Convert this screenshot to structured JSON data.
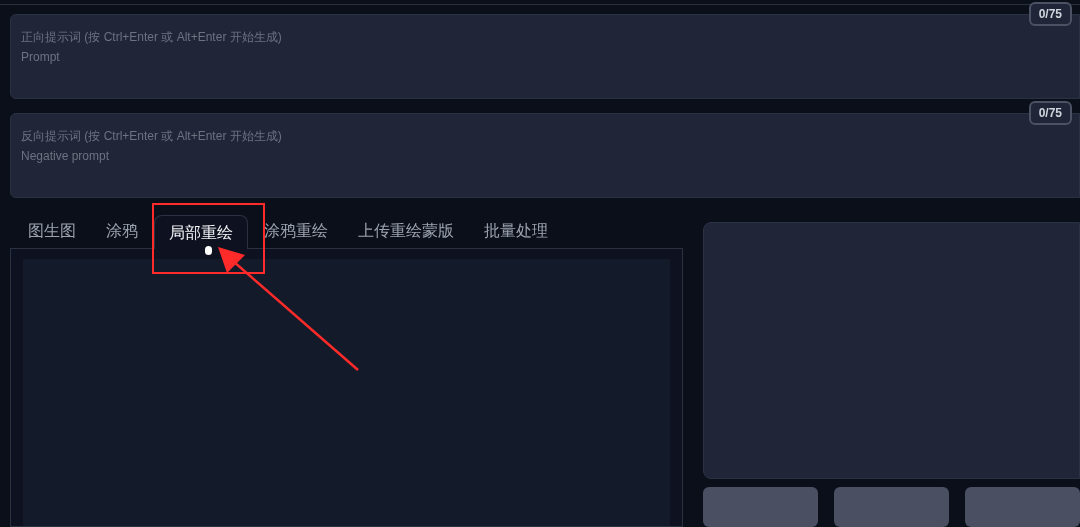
{
  "prompts": [
    {
      "placeholder": "正向提示词 (按 Ctrl+Enter 或 Alt+Enter 开始生成)\nPrompt",
      "counter": "0/75"
    },
    {
      "placeholder": "反向提示词 (按 Ctrl+Enter 或 Alt+Enter 开始生成)\nNegative prompt",
      "counter": "0/75"
    }
  ],
  "tabs": [
    {
      "label": "图生图",
      "selected": false
    },
    {
      "label": "涂鸦",
      "selected": false
    },
    {
      "label": "局部重绘",
      "selected": true
    },
    {
      "label": "涂鸦重绘",
      "selected": false
    },
    {
      "label": "上传重绘蒙版",
      "selected": false
    },
    {
      "label": "批量处理",
      "selected": false
    }
  ]
}
